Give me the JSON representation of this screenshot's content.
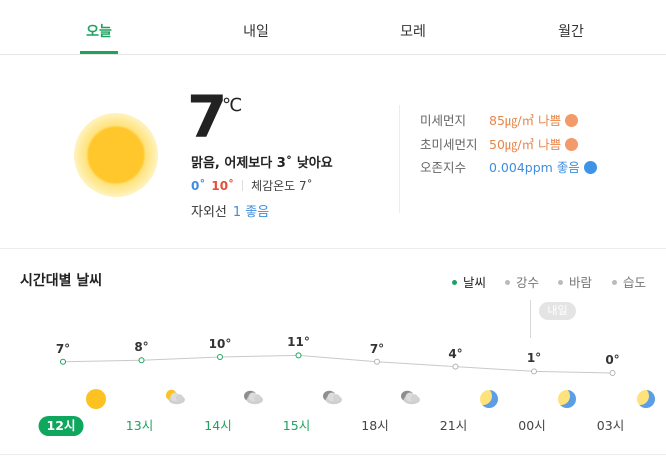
{
  "tabs": [
    {
      "label": "오늘",
      "active": true
    },
    {
      "label": "내일",
      "active": false
    },
    {
      "label": "모레",
      "active": false
    },
    {
      "label": "월간",
      "active": false
    }
  ],
  "current": {
    "icon": "sun-icon",
    "temp": "7",
    "unit": "℃",
    "summary": "맑음, 어제보다 3˚ 낮아요",
    "min": "0˚",
    "max": "10˚",
    "feels": "체감온도 7˚",
    "uv_label": "자외선",
    "uv_value": "1 좋음"
  },
  "air": [
    {
      "label": "미세먼지",
      "value": "85㎍/㎥ 나쁨",
      "status": "bad"
    },
    {
      "label": "초미세먼지",
      "value": "50㎍/㎥ 나쁨",
      "status": "bad"
    },
    {
      "label": "오존지수",
      "value": "0.004ppm 좋음",
      "status": "good"
    }
  ],
  "hourly": {
    "title": "시간대별 날씨",
    "legend": [
      {
        "label": "날씨",
        "active": true
      },
      {
        "label": "강수",
        "active": false
      },
      {
        "label": "바람",
        "active": false
      },
      {
        "label": "습도",
        "active": false
      }
    ],
    "tomorrow_badge": "내일",
    "hours": [
      {
        "time": "12시",
        "temp": "7°",
        "value": 7,
        "icon": "sun-icon",
        "style": "now"
      },
      {
        "time": "13시",
        "temp": "8°",
        "value": 8,
        "icon": "partly-cloudy-icon",
        "style": "green"
      },
      {
        "time": "14시",
        "temp": "10°",
        "value": 10,
        "icon": "cloudy-icon",
        "style": "green"
      },
      {
        "time": "15시",
        "temp": "11°",
        "value": 11,
        "icon": "cloudy-icon",
        "style": "green"
      },
      {
        "time": "18시",
        "temp": "7°",
        "value": 7,
        "icon": "cloudy-icon",
        "style": "gray"
      },
      {
        "time": "21시",
        "temp": "4°",
        "value": 4,
        "icon": "moon-icon",
        "style": "gray"
      },
      {
        "time": "00시",
        "temp": "1°",
        "value": 1,
        "icon": "moon-icon",
        "style": "gray"
      },
      {
        "time": "03시",
        "temp": "0°",
        "value": 0,
        "icon": "moon-icon",
        "style": "gray"
      }
    ],
    "colors": {
      "line": "#c9c9c9",
      "point_day": "#1ea35f",
      "point_night": "#b3b3b3"
    }
  }
}
